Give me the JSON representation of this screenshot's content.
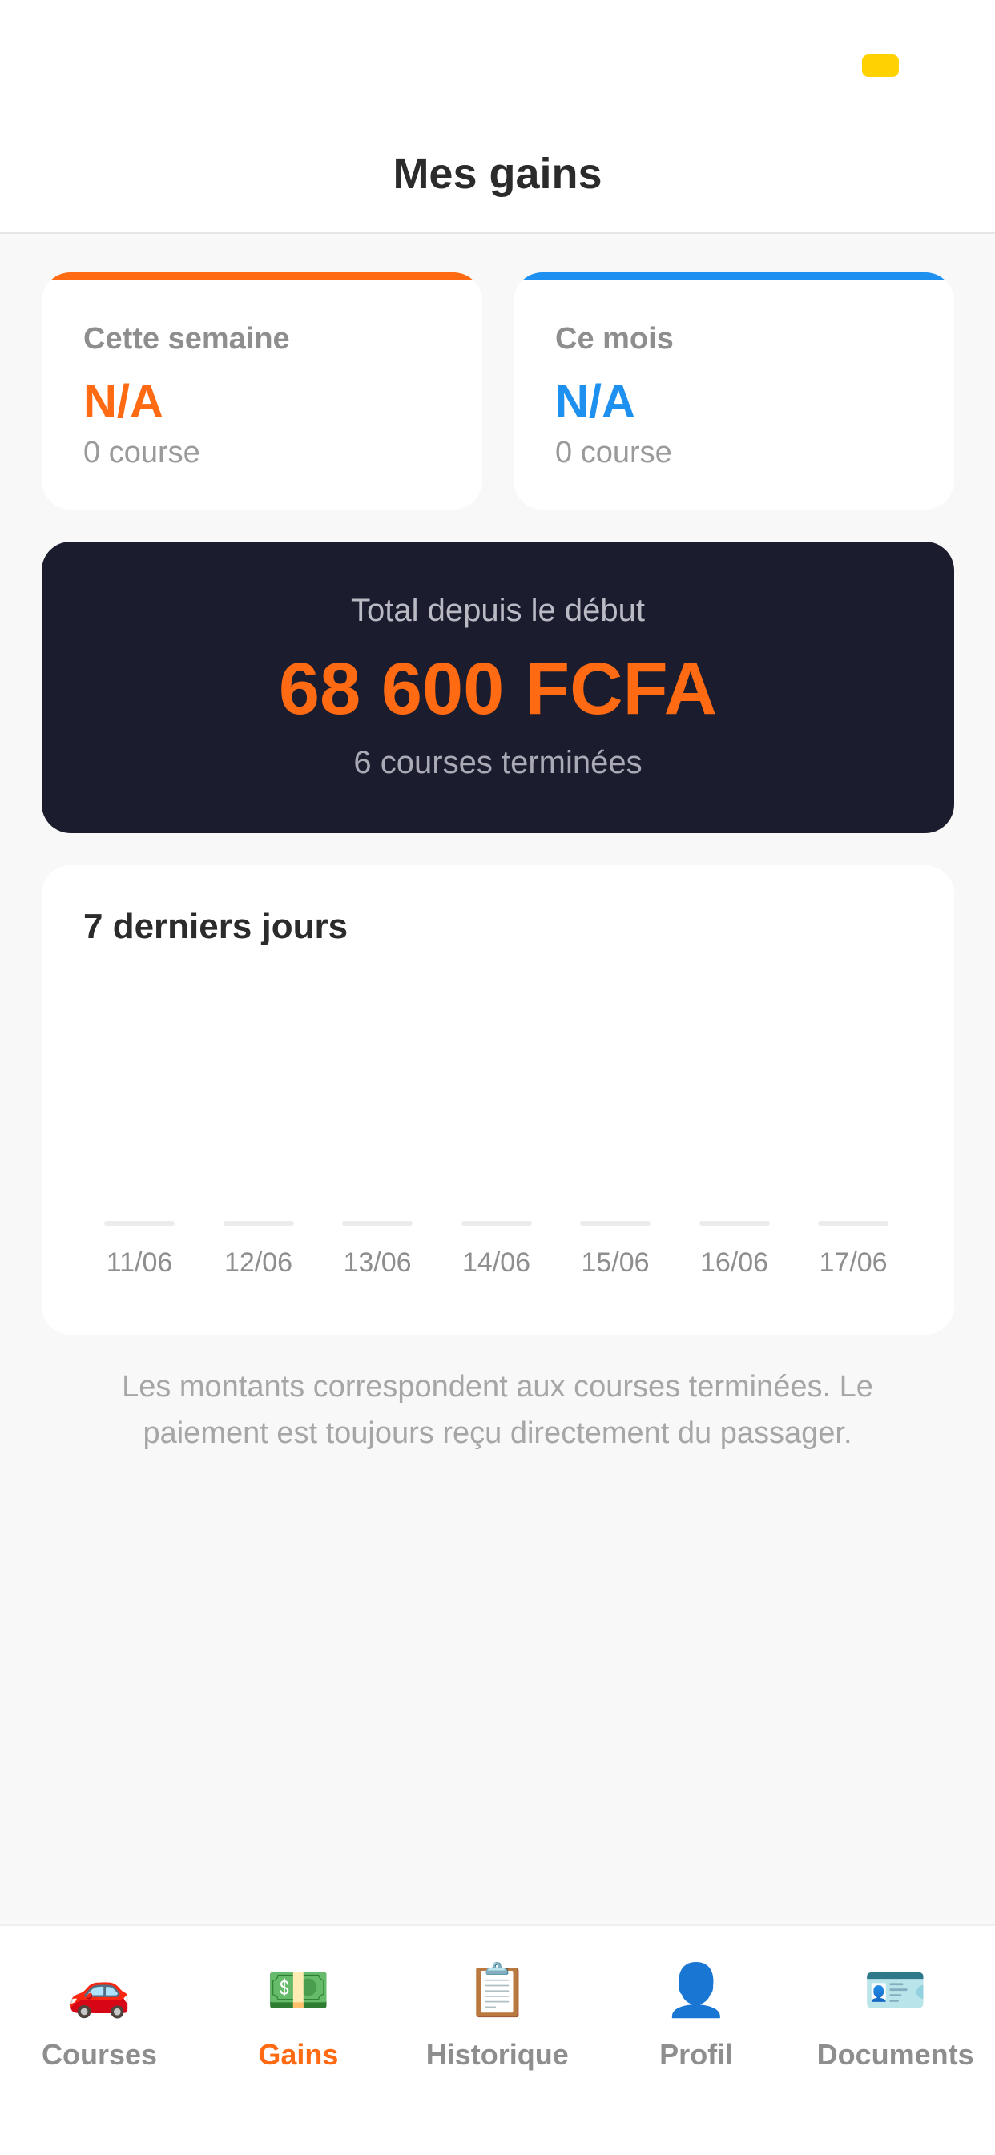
{
  "header": {
    "title": "Mes gains"
  },
  "stats": {
    "week": {
      "label": "Cette semaine",
      "value": "N/A",
      "sub": "0 course",
      "accent": "#ff6a13"
    },
    "month": {
      "label": "Ce mois",
      "value": "N/A",
      "sub": "0 course",
      "accent": "#1e90f0"
    }
  },
  "total": {
    "label": "Total depuis le début",
    "amount": "68 600 FCFA",
    "sub": "6 courses terminées",
    "background": "#1b1c2e",
    "amount_color": "#ff6a13"
  },
  "chart": {
    "title": "7 derniers jours"
  },
  "chart_data": {
    "type": "bar",
    "title": "7 derniers jours",
    "categories": [
      "11/06",
      "12/06",
      "13/06",
      "14/06",
      "15/06",
      "16/06",
      "17/06"
    ],
    "values": [
      0,
      0,
      0,
      0,
      0,
      0,
      0
    ],
    "grid": false
  },
  "note": "Les montants correspondent aux courses terminées. Le paiement est toujours reçu directement du passager.",
  "tabs": [
    {
      "id": "courses",
      "label": "Courses",
      "icon": "🚗",
      "icon_name": "car-icon",
      "active": false
    },
    {
      "id": "gains",
      "label": "Gains",
      "icon": "💵",
      "icon_name": "money-icon",
      "active": true
    },
    {
      "id": "historique",
      "label": "Historique",
      "icon": "📋",
      "icon_name": "clipboard-icon",
      "active": false
    },
    {
      "id": "profil",
      "label": "Profil",
      "icon": "👤",
      "icon_name": "profile-icon",
      "active": false
    },
    {
      "id": "documents",
      "label": "Documents",
      "icon": "🪪",
      "icon_name": "id-card-icon",
      "active": false
    }
  ],
  "colors": {
    "accent": "#ff6a13",
    "blue": "#1e90f0",
    "status_pill": "#ffd200"
  }
}
